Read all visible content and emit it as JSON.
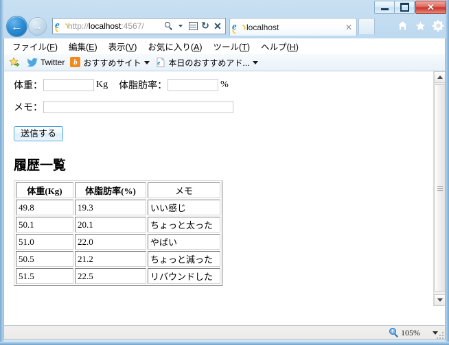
{
  "window": {
    "minimize_label": "Minimize",
    "maximize_label": "Maximize",
    "close_label": "✕"
  },
  "navigation": {
    "back_label": "←",
    "forward_label": "→",
    "address": {
      "scheme": "http://",
      "host": "localhost",
      "rest": ":4567/",
      "full_url": "http://localhost:4567/"
    },
    "address_icons": [
      "search-icon",
      "dropdown-arrow-icon",
      "compatibility-view-icon",
      "refresh-icon",
      "stop-icon"
    ],
    "refresh_glyph": "↻",
    "stop_glyph": "✕",
    "tab": {
      "title": "localhost",
      "close_label": "✕"
    },
    "toolbar_icons": [
      "home-icon",
      "favorites-star-icon",
      "tools-gear-icon"
    ]
  },
  "menubar": {
    "items": [
      {
        "prefix": "ファイル(",
        "key": "F",
        "suffix": ")"
      },
      {
        "prefix": "編集(",
        "key": "E",
        "suffix": ")"
      },
      {
        "prefix": "表示(",
        "key": "V",
        "suffix": ")"
      },
      {
        "prefix": "お気に入り(",
        "key": "A",
        "suffix": ")"
      },
      {
        "prefix": "ツール(",
        "key": "T",
        "suffix": ")"
      },
      {
        "prefix": "ヘルプ(",
        "key": "H",
        "suffix": ")"
      }
    ]
  },
  "favorites_bar": {
    "add_icon": "add-to-favorites-icon",
    "items": [
      {
        "label": "Twitter",
        "icon": "twitter-bird-icon",
        "has_caret": false
      },
      {
        "label": "おすすめサイト",
        "icon": "bing-b-icon",
        "has_caret": true
      },
      {
        "label": "本日のおすすめアド...",
        "icon": "ie-page-icon",
        "has_caret": true
      }
    ]
  },
  "page": {
    "form": {
      "weight_label": "体重：",
      "weight_value": "",
      "weight_unit": "Kg",
      "fat_label": "体脂肪率：",
      "fat_value": "",
      "fat_unit": "%",
      "memo_label": "メモ：",
      "memo_value": "",
      "submit_label": "送信する"
    },
    "heading": "履歴一覧",
    "table": {
      "headers": [
        "体重(Kg)",
        "体脂肪率(%)",
        "メモ"
      ],
      "rows": [
        [
          "49.8",
          "19.3",
          "いい感じ"
        ],
        [
          "50.1",
          "20.1",
          "ちょっと太った"
        ],
        [
          "51.0",
          "22.0",
          "やばい"
        ],
        [
          "50.5",
          "21.2",
          "ちょっと減った"
        ],
        [
          "51.5",
          "22.5",
          "リバウンドした"
        ]
      ]
    }
  },
  "statusbar": {
    "zoom_level": "105%",
    "zoom_plus": "+"
  },
  "colors": {
    "accent_blue": "#2d8fd6",
    "close_red": "#c93426",
    "button_border": "#3c9fd4",
    "bing_orange": "#f08a1c",
    "twitter_blue": "#4ea6e0"
  }
}
